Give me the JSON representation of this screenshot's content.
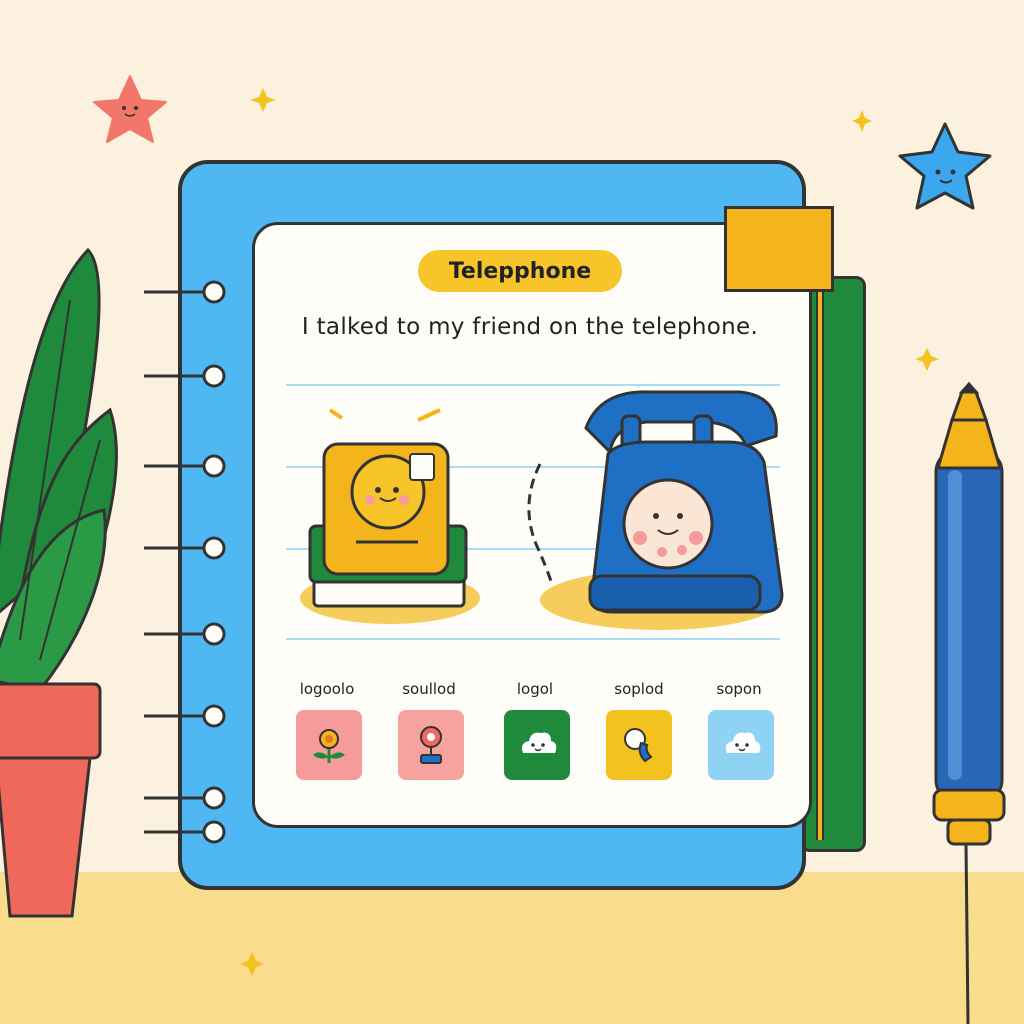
{
  "worksheet": {
    "title": "Telepphone",
    "sentence": "I talked to my friend on the telephone.",
    "cards": [
      {
        "label": "logoolo",
        "color": "#f59b9b",
        "icon": "flower-icon"
      },
      {
        "label": "soullod",
        "color": "#f6a3a0",
        "icon": "webcam-icon"
      },
      {
        "label": "logol",
        "color": "#1f8a3b",
        "icon": "cloud-face-icon"
      },
      {
        "label": "soplod",
        "color": "#f4c21f",
        "icon": "phone-receiver-icon"
      },
      {
        "label": "sopon",
        "color": "#8fd3f4",
        "icon": "cloud-face-icon"
      }
    ]
  },
  "palette": {
    "cover": "#4fb8f2",
    "page": "#fffdf8",
    "tab": "#f4b41c",
    "telephone": "#1f6fc4",
    "pot": "#f0685a",
    "plant": "#1f8a3b"
  }
}
